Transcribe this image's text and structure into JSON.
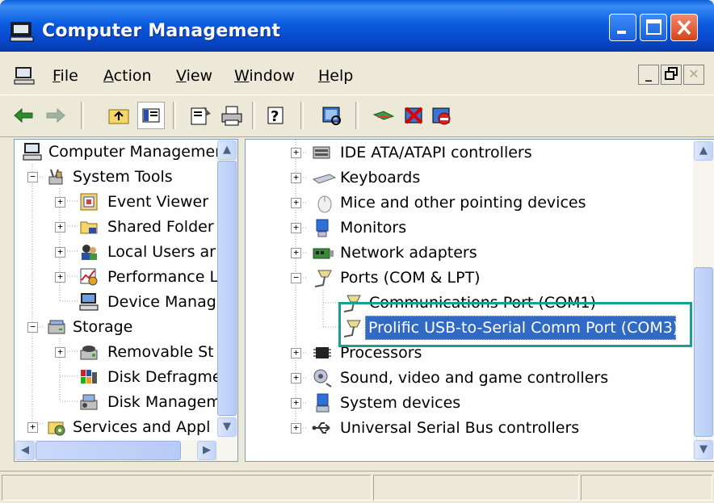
{
  "window": {
    "title": "Computer Management",
    "buttons": {
      "minimize": "minimize",
      "maximize": "maximize",
      "close": "close"
    }
  },
  "menu": {
    "items": [
      {
        "label": "File",
        "accel": "F"
      },
      {
        "label": "Action",
        "accel": "A"
      },
      {
        "label": "View",
        "accel": "V"
      },
      {
        "label": "Window",
        "accel": "W"
      },
      {
        "label": "Help",
        "accel": "H"
      }
    ]
  },
  "toolbar": {
    "icons": [
      "back-arrow-icon",
      "forward-arrow-icon",
      "up-one-level-icon",
      "show-hide-console-tree-icon",
      "properties-icon",
      "print-icon",
      "help-icon",
      "scan-hardware-icon",
      "update-driver-icon",
      "uninstall-icon",
      "disable-icon"
    ]
  },
  "left_tree": {
    "items": [
      {
        "label": "Computer Managemer",
        "icon": "computer-icon"
      },
      {
        "label": "System Tools",
        "icon": "tools-icon"
      },
      {
        "label": "Event Viewer",
        "icon": "event-viewer-icon"
      },
      {
        "label": "Shared Folder",
        "icon": "shared-folder-icon"
      },
      {
        "label": "Local Users ar",
        "icon": "users-icon"
      },
      {
        "label": "Performance L",
        "icon": "performance-icon"
      },
      {
        "label": "Device Manag",
        "icon": "device-manager-icon"
      },
      {
        "label": "Storage",
        "icon": "storage-icon"
      },
      {
        "label": "Removable St",
        "icon": "removable-storage-icon"
      },
      {
        "label": "Disk Defragme",
        "icon": "defrag-icon"
      },
      {
        "label": "Disk Managem",
        "icon": "disk-management-icon"
      },
      {
        "label": "Services and Appl",
        "icon": "services-icon"
      }
    ]
  },
  "right_tree": {
    "items": [
      {
        "label": "IDE ATA/ATAPI controllers",
        "icon": "ide-controller-icon"
      },
      {
        "label": "Keyboards",
        "icon": "keyboard-icon"
      },
      {
        "label": "Mice and other pointing devices",
        "icon": "mouse-icon"
      },
      {
        "label": "Monitors",
        "icon": "monitor-icon"
      },
      {
        "label": "Network adapters",
        "icon": "network-adapter-icon"
      },
      {
        "label": "Ports (COM & LPT)",
        "icon": "port-icon"
      },
      {
        "label": "Communications Port (COM1)",
        "icon": "port-icon"
      },
      {
        "label": "Prolific USB-to-Serial Comm Port (COM3)",
        "icon": "port-icon"
      },
      {
        "label": "Processors",
        "icon": "processor-icon"
      },
      {
        "label": "Sound, video and game controllers",
        "icon": "sound-icon"
      },
      {
        "label": "System devices",
        "icon": "system-devices-icon"
      },
      {
        "label": "Universal Serial Bus controllers",
        "icon": "usb-icon"
      }
    ]
  },
  "colors": {
    "selection": "#316ac5",
    "highlight_box": "#179e96",
    "titlebar": "#0a5fd8"
  }
}
